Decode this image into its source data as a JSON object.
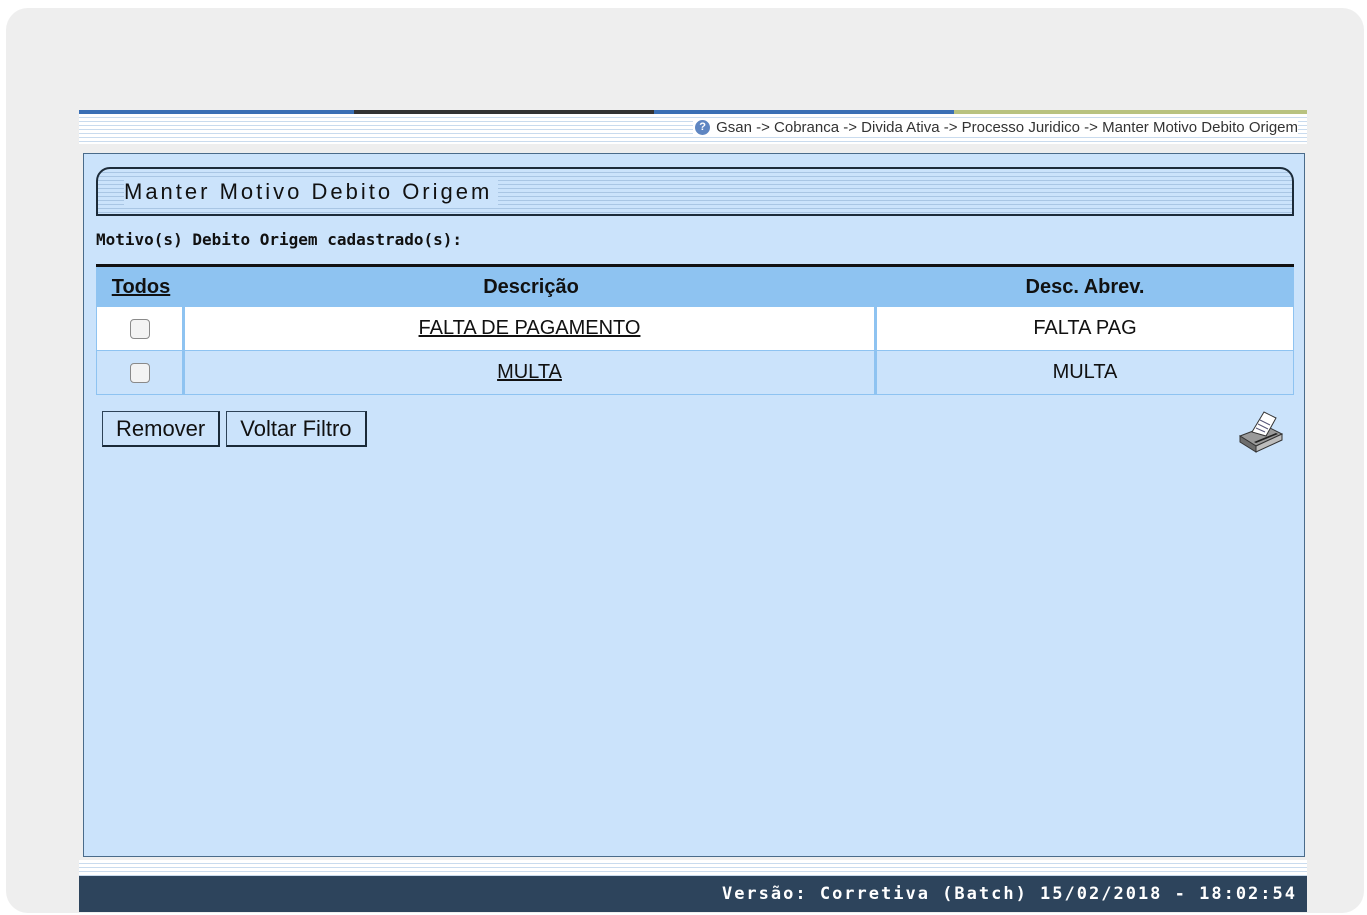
{
  "breadcrumb": "Gsan -> Cobranca -> Divida Ativa -> Processo Juridico -> Manter Motivo Debito Origem",
  "page_title": "Manter Motivo Debito Origem",
  "subtitle": "Motivo(s) Debito Origem cadastrado(s):",
  "table": {
    "headers": {
      "select_all": "Todos",
      "description": "Descrição",
      "abbrev": "Desc. Abrev."
    },
    "rows": [
      {
        "description": "FALTA DE PAGAMENTO",
        "abbrev": "FALTA PAG",
        "checked": false
      },
      {
        "description": "MULTA",
        "abbrev": "MULTA",
        "checked": false
      }
    ]
  },
  "buttons": {
    "remove": "Remover",
    "back": "Voltar Filtro"
  },
  "footer": "Versão: Corretiva (Batch) 15/02/2018 - 18:02:54",
  "icons": {
    "help": "help-icon",
    "print": "printer-icon"
  },
  "colors": {
    "panel": "#cbe3fb",
    "header_row": "#8ec3f1",
    "footer": "#2d445c"
  }
}
